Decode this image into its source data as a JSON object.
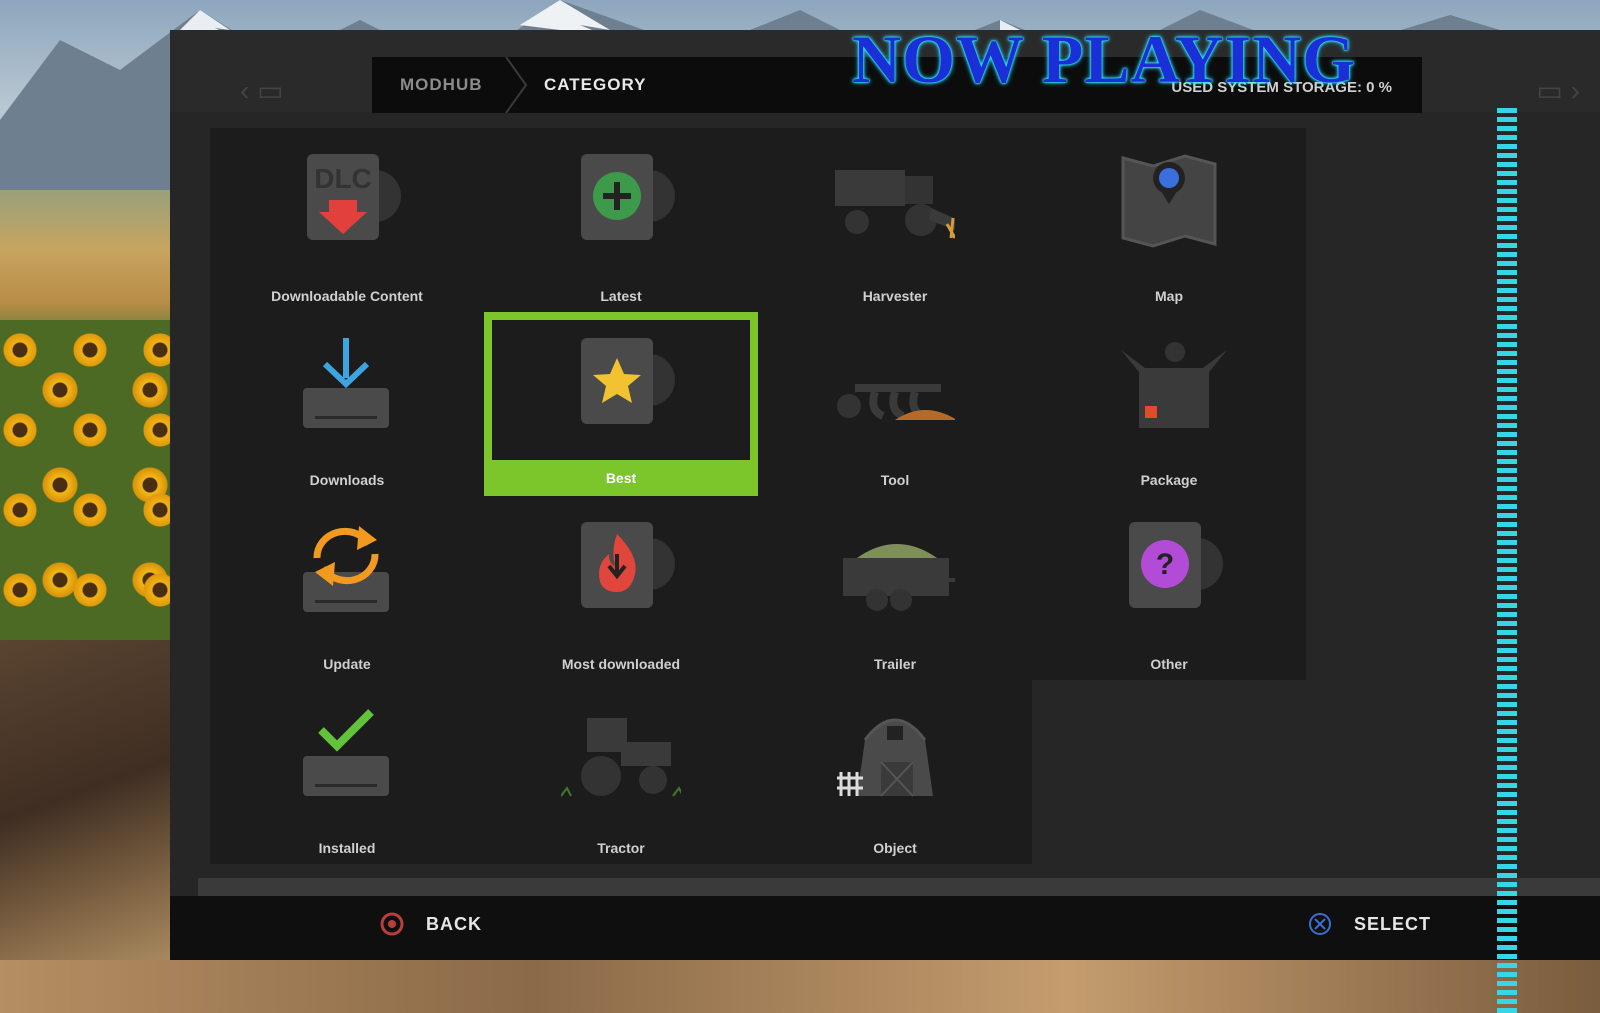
{
  "overlay": {
    "now_playing": "NOW PLAYING"
  },
  "header": {
    "breadcrumb": [
      "MODHUB",
      "CATEGORY"
    ],
    "storage_text": "USED SYSTEM STORAGE: 0 %"
  },
  "tiles": [
    {
      "label": "Downloadable Content",
      "icon": "dlc-icon"
    },
    {
      "label": "Latest",
      "icon": "latest-icon"
    },
    {
      "label": "Harvester",
      "icon": "harvester-icon"
    },
    {
      "label": "Map",
      "icon": "map-icon"
    },
    {
      "label": "Downloads",
      "icon": "downloads-icon"
    },
    {
      "label": "Best",
      "icon": "best-star-icon",
      "selected": true
    },
    {
      "label": "Tool",
      "icon": "tool-icon"
    },
    {
      "label": "Package",
      "icon": "package-icon"
    },
    {
      "label": "Update",
      "icon": "update-icon"
    },
    {
      "label": "Most downloaded",
      "icon": "most-downloaded-icon"
    },
    {
      "label": "Trailer",
      "icon": "trailer-icon"
    },
    {
      "label": "Other",
      "icon": "other-icon"
    },
    {
      "label": "Installed",
      "icon": "installed-icon"
    },
    {
      "label": "Tractor",
      "icon": "tractor-icon"
    },
    {
      "label": "Object",
      "icon": "object-barn-icon"
    }
  ],
  "footer": {
    "back_label": "BACK",
    "select_label": "SELECT"
  },
  "colors": {
    "accent": "#7cc52a",
    "panel": "#262626",
    "tile": "#1c1c1c"
  }
}
